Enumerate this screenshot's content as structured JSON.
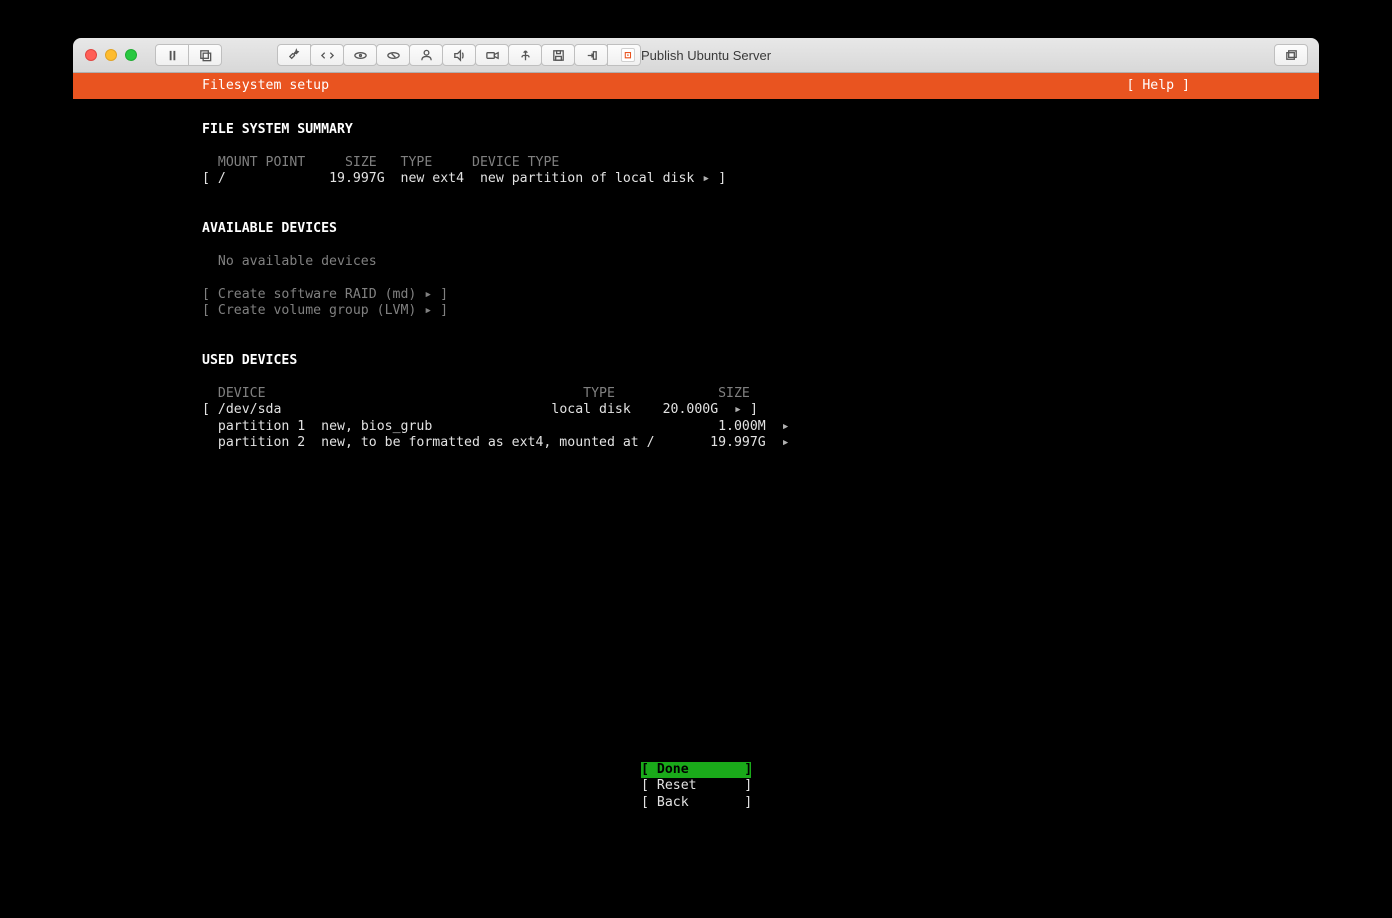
{
  "window": {
    "title": "Publish Ubuntu Server"
  },
  "header": {
    "title": "Filesystem setup",
    "help": "[ Help ]"
  },
  "summary": {
    "heading": "FILE SYSTEM SUMMARY",
    "columns": {
      "mount": "MOUNT POINT",
      "size": "SIZE",
      "type": "TYPE",
      "devtype": "DEVICE TYPE"
    },
    "row": {
      "open": "[",
      "mount": "/",
      "size": "19.997G",
      "type": "new ext4",
      "devtype": "new partition of local disk",
      "arrow": "▸",
      "close": "]"
    }
  },
  "available": {
    "heading": "AVAILABLE DEVICES",
    "empty": "No available devices",
    "raid": "[ Create software RAID (md) ▸ ]",
    "lvm": "[ Create volume group (LVM) ▸ ]"
  },
  "used": {
    "heading": "USED DEVICES",
    "columns": {
      "device": "DEVICE",
      "type": "TYPE",
      "size": "SIZE"
    },
    "rows": [
      {
        "open": "[",
        "name": "/dev/sda",
        "type": "local disk",
        "size": "20.000G",
        "arrow": "▸",
        "close": "]"
      },
      {
        "name": "partition 1",
        "desc": "new, bios_grub",
        "size": "1.000M",
        "arrow": "▸"
      },
      {
        "name": "partition 2",
        "desc": "new, to be formatted as ext4, mounted at /",
        "size": "19.997G",
        "arrow": "▸"
      }
    ]
  },
  "buttons": {
    "done": "[ Done       ]",
    "reset": "[ Reset      ]",
    "back": "[ Back       ]"
  }
}
